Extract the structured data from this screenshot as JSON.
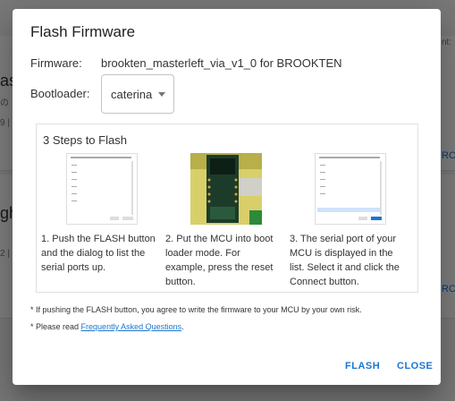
{
  "background": {
    "frag1": "as",
    "frag2": "の",
    "frag3": "9 |",
    "frag4": "gh",
    "frag5": "2 |",
    "frag6": "nt:",
    "frag7": "RCE",
    "frag8": "RCE"
  },
  "dialog": {
    "title": "Flash Firmware",
    "firmware_label": "Firmware:",
    "firmware_value": "brookten_masterleft_via_v1_0 for BROOKTEN",
    "bootloader_label": "Bootloader:",
    "bootloader_selected": "caterina",
    "steps_title": "3 Steps to Flash",
    "steps": [
      {
        "text": "1. Push the FLASH button and the dialog to list the serial ports up."
      },
      {
        "text": "2. Put the MCU into boot loader mode. For example, press the reset button."
      },
      {
        "text": "3. The serial port of your MCU is displayed in the list. Select it and click the Connect button."
      }
    ],
    "note1": "* If pushing the FLASH button, you agree to write the firmware to your MCU by your own risk.",
    "note2_prefix": "* Please read ",
    "note2_link": "Frequently Asked Questions",
    "note2_suffix": ".",
    "flash_label": "FLASH",
    "close_label": "CLOSE"
  },
  "colors": {
    "accent": "#1976d2",
    "scrim": "rgba(0,0,0,0.5)"
  },
  "icons": [
    "chevron-down-icon"
  ]
}
